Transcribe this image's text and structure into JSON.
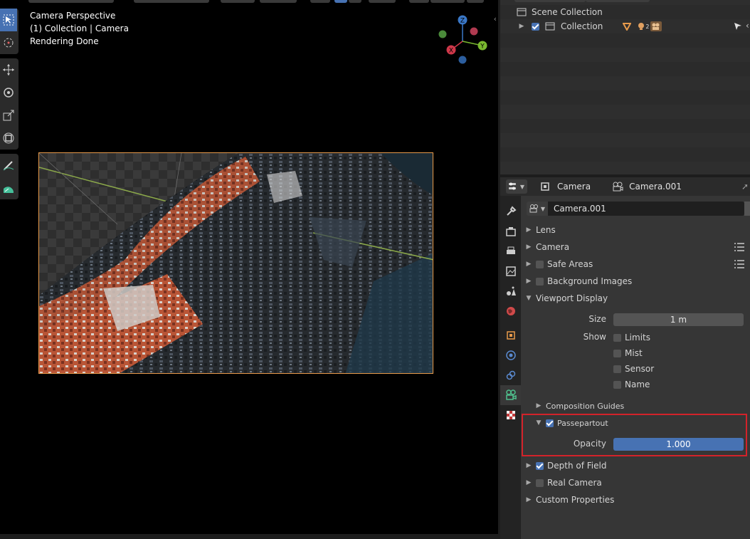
{
  "viewport": {
    "overlay_lines": [
      "Camera Perspective",
      "(1) Collection | Camera",
      "Rendering Done"
    ],
    "tools": [
      "select-box",
      "cursor",
      "move",
      "rotate",
      "scale",
      "transform",
      "annotate",
      "measure"
    ],
    "gizmo": {
      "z": "Z",
      "y": "Y",
      "x": "X"
    },
    "frame_color": "#e79a4b"
  },
  "outliner": {
    "scene_collection": "Scene Collection",
    "collection": "Collection",
    "object_count": "2"
  },
  "properties": {
    "header": {
      "object": "Camera",
      "data": "Camera.001"
    },
    "datablock_name": "Camera.001",
    "panels": {
      "lens": "Lens",
      "camera": "Camera",
      "safe_areas": "Safe Areas",
      "background_images": "Background Images",
      "viewport_display": "Viewport Display",
      "depth_of_field": "Depth of Field",
      "real_camera": "Real Camera",
      "custom_properties": "Custom Properties"
    },
    "viewport_display": {
      "size_label": "Size",
      "size_value": "1 m",
      "show_label": "Show",
      "show_options": [
        "Limits",
        "Mist",
        "Sensor",
        "Name"
      ],
      "composition_guides": "Composition Guides",
      "passepartout": "Passepartout",
      "opacity_label": "Opacity",
      "opacity_value": "1.000"
    },
    "accent": "#4772b3",
    "highlight_color": "#d3222a"
  }
}
